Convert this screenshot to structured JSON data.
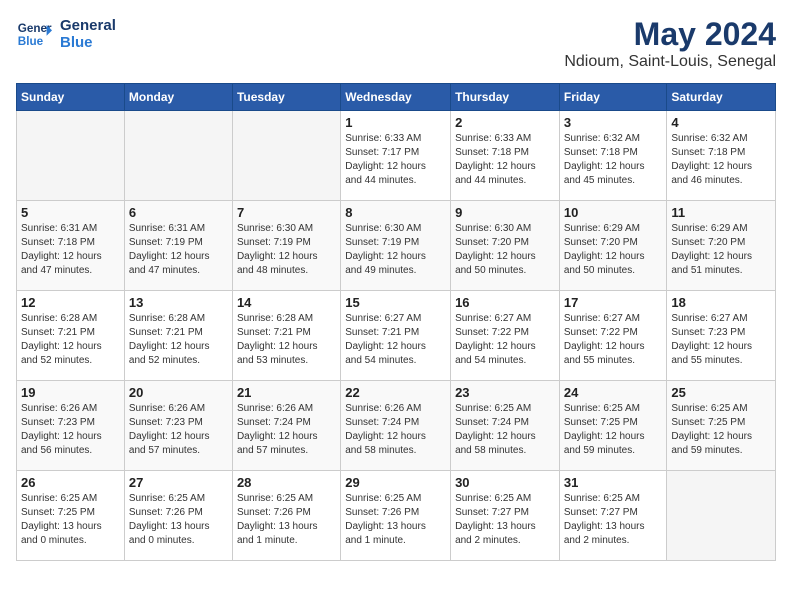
{
  "header": {
    "logo_line1": "General",
    "logo_line2": "Blue",
    "title": "May 2024",
    "subtitle": "Ndioum, Saint-Louis, Senegal"
  },
  "calendar": {
    "headers": [
      "Sunday",
      "Monday",
      "Tuesday",
      "Wednesday",
      "Thursday",
      "Friday",
      "Saturday"
    ],
    "weeks": [
      [
        {
          "day": "",
          "info": ""
        },
        {
          "day": "",
          "info": ""
        },
        {
          "day": "",
          "info": ""
        },
        {
          "day": "1",
          "info": "Sunrise: 6:33 AM\nSunset: 7:17 PM\nDaylight: 12 hours\nand 44 minutes."
        },
        {
          "day": "2",
          "info": "Sunrise: 6:33 AM\nSunset: 7:18 PM\nDaylight: 12 hours\nand 44 minutes."
        },
        {
          "day": "3",
          "info": "Sunrise: 6:32 AM\nSunset: 7:18 PM\nDaylight: 12 hours\nand 45 minutes."
        },
        {
          "day": "4",
          "info": "Sunrise: 6:32 AM\nSunset: 7:18 PM\nDaylight: 12 hours\nand 46 minutes."
        }
      ],
      [
        {
          "day": "5",
          "info": "Sunrise: 6:31 AM\nSunset: 7:18 PM\nDaylight: 12 hours\nand 47 minutes."
        },
        {
          "day": "6",
          "info": "Sunrise: 6:31 AM\nSunset: 7:19 PM\nDaylight: 12 hours\nand 47 minutes."
        },
        {
          "day": "7",
          "info": "Sunrise: 6:30 AM\nSunset: 7:19 PM\nDaylight: 12 hours\nand 48 minutes."
        },
        {
          "day": "8",
          "info": "Sunrise: 6:30 AM\nSunset: 7:19 PM\nDaylight: 12 hours\nand 49 minutes."
        },
        {
          "day": "9",
          "info": "Sunrise: 6:30 AM\nSunset: 7:20 PM\nDaylight: 12 hours\nand 50 minutes."
        },
        {
          "day": "10",
          "info": "Sunrise: 6:29 AM\nSunset: 7:20 PM\nDaylight: 12 hours\nand 50 minutes."
        },
        {
          "day": "11",
          "info": "Sunrise: 6:29 AM\nSunset: 7:20 PM\nDaylight: 12 hours\nand 51 minutes."
        }
      ],
      [
        {
          "day": "12",
          "info": "Sunrise: 6:28 AM\nSunset: 7:21 PM\nDaylight: 12 hours\nand 52 minutes."
        },
        {
          "day": "13",
          "info": "Sunrise: 6:28 AM\nSunset: 7:21 PM\nDaylight: 12 hours\nand 52 minutes."
        },
        {
          "day": "14",
          "info": "Sunrise: 6:28 AM\nSunset: 7:21 PM\nDaylight: 12 hours\nand 53 minutes."
        },
        {
          "day": "15",
          "info": "Sunrise: 6:27 AM\nSunset: 7:21 PM\nDaylight: 12 hours\nand 54 minutes."
        },
        {
          "day": "16",
          "info": "Sunrise: 6:27 AM\nSunset: 7:22 PM\nDaylight: 12 hours\nand 54 minutes."
        },
        {
          "day": "17",
          "info": "Sunrise: 6:27 AM\nSunset: 7:22 PM\nDaylight: 12 hours\nand 55 minutes."
        },
        {
          "day": "18",
          "info": "Sunrise: 6:27 AM\nSunset: 7:23 PM\nDaylight: 12 hours\nand 55 minutes."
        }
      ],
      [
        {
          "day": "19",
          "info": "Sunrise: 6:26 AM\nSunset: 7:23 PM\nDaylight: 12 hours\nand 56 minutes."
        },
        {
          "day": "20",
          "info": "Sunrise: 6:26 AM\nSunset: 7:23 PM\nDaylight: 12 hours\nand 57 minutes."
        },
        {
          "day": "21",
          "info": "Sunrise: 6:26 AM\nSunset: 7:24 PM\nDaylight: 12 hours\nand 57 minutes."
        },
        {
          "day": "22",
          "info": "Sunrise: 6:26 AM\nSunset: 7:24 PM\nDaylight: 12 hours\nand 58 minutes."
        },
        {
          "day": "23",
          "info": "Sunrise: 6:25 AM\nSunset: 7:24 PM\nDaylight: 12 hours\nand 58 minutes."
        },
        {
          "day": "24",
          "info": "Sunrise: 6:25 AM\nSunset: 7:25 PM\nDaylight: 12 hours\nand 59 minutes."
        },
        {
          "day": "25",
          "info": "Sunrise: 6:25 AM\nSunset: 7:25 PM\nDaylight: 12 hours\nand 59 minutes."
        }
      ],
      [
        {
          "day": "26",
          "info": "Sunrise: 6:25 AM\nSunset: 7:25 PM\nDaylight: 13 hours\nand 0 minutes."
        },
        {
          "day": "27",
          "info": "Sunrise: 6:25 AM\nSunset: 7:26 PM\nDaylight: 13 hours\nand 0 minutes."
        },
        {
          "day": "28",
          "info": "Sunrise: 6:25 AM\nSunset: 7:26 PM\nDaylight: 13 hours\nand 1 minute."
        },
        {
          "day": "29",
          "info": "Sunrise: 6:25 AM\nSunset: 7:26 PM\nDaylight: 13 hours\nand 1 minute."
        },
        {
          "day": "30",
          "info": "Sunrise: 6:25 AM\nSunset: 7:27 PM\nDaylight: 13 hours\nand 2 minutes."
        },
        {
          "day": "31",
          "info": "Sunrise: 6:25 AM\nSunset: 7:27 PM\nDaylight: 13 hours\nand 2 minutes."
        },
        {
          "day": "",
          "info": ""
        }
      ]
    ]
  }
}
